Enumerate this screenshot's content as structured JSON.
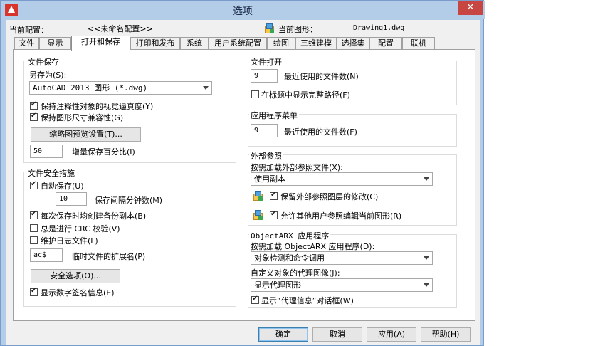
{
  "window": {
    "title": "选项",
    "close_glyph": "✕"
  },
  "header": {
    "profile_label": "当前配置：",
    "profile_value": "<<未命名配置>>",
    "drawing_label": "当前图形：",
    "drawing_value": "Drawing1.dwg"
  },
  "tabs": [
    "文件",
    "显示",
    "打开和保存",
    "打印和发布",
    "系统",
    "用户系统配置",
    "绘图",
    "三维建模",
    "选择集",
    "配置",
    "联机"
  ],
  "file_save": {
    "group": "文件保存",
    "saveas_label": "另存为(S):",
    "saveas_value": "AutoCAD 2013 图形 (*.dwg)",
    "chk_annotative": "保持注释性对象的视觉逼真度(Y)",
    "chk_drawing_size": "保持图形尺寸兼容性(G)",
    "thumb_button": "缩略图预览设置(T)...",
    "incremental_value": "50",
    "incremental_label": "增量保存百分比(I)"
  },
  "file_safety": {
    "group": "文件安全措施",
    "chk_autosave": "自动保存(U)",
    "autosave_minutes": "10",
    "autosave_label": "保存间隔分钟数(M)",
    "chk_backup": "每次保存时均创建备份副本(B)",
    "chk_crc": "总是进行 CRC 校验(V)",
    "chk_log": "维护日志文件(L)",
    "temp_ext_value": "ac$",
    "temp_ext_label": "临时文件的扩展名(P)",
    "security_button": "安全选项(O)...",
    "chk_signature": "显示数字签名信息(E)"
  },
  "file_open": {
    "group": "文件打开",
    "recent_value": "9",
    "recent_label": "最近使用的文件数(N)",
    "chk_fullpath": "在标题中显示完整路径(F)"
  },
  "app_menu": {
    "group": "应用程序菜单",
    "recent_value": "9",
    "recent_label": "最近使用的文件数(F)"
  },
  "xref": {
    "group": "外部参照",
    "demand_label": "按需加载外部参照文件(X):",
    "demand_value": "使用副本",
    "chk_retain": "保留外部参照图层的修改(C)",
    "chk_allow": "允许其他用户参照编辑当前图形(R)"
  },
  "objectarx": {
    "group": "ObjectARX 应用程序",
    "demand_label": "按需加载 ObjectARX 应用程序(D):",
    "demand_value": "对象检测和命令调用",
    "proxy_label": "自定义对象的代理图像(J):",
    "proxy_value": "显示代理图形",
    "chk_proxy_info": "显示“代理信息”对话框(W)"
  },
  "footer": {
    "ok": "确定",
    "cancel": "取消",
    "apply": "应用(A)",
    "help": "帮助(H)"
  }
}
